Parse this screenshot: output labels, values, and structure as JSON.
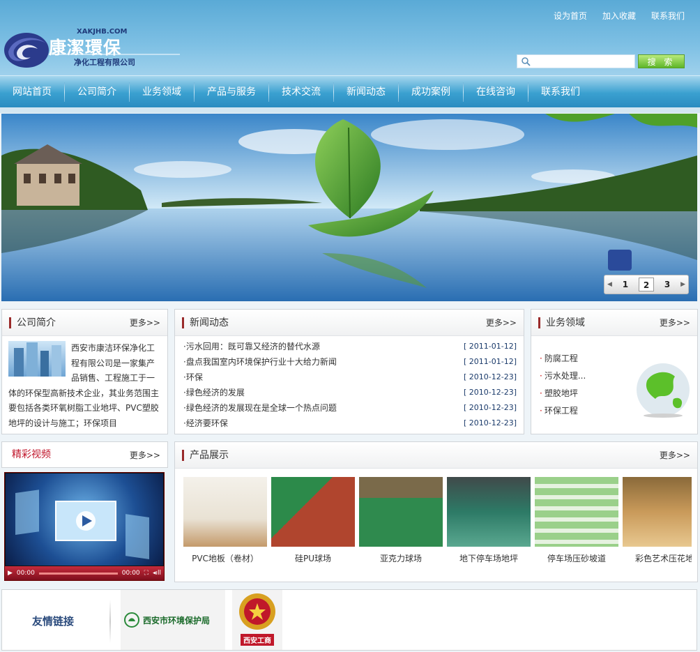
{
  "header": {
    "logo_domain": "XAKJHB.COM",
    "logo_name": "康潔環保",
    "logo_sub": "净化工程有限公司",
    "top_links": [
      "设为首页",
      "加入收藏",
      "联系我们"
    ],
    "search_placeholder": "",
    "search_button": "搜 索"
  },
  "nav": [
    "网站首页",
    "公司简介",
    "业务领域",
    "产品与服务",
    "技术交流",
    "新闻动态",
    "成功案例",
    "在线咨询",
    "联系我们"
  ],
  "banner": {
    "pages": [
      "1",
      "2",
      "3"
    ],
    "active_page": "2"
  },
  "about": {
    "title": "公司简介",
    "more": "更多>>",
    "text": "西安市康洁环保净化工程有限公司是一家集产品销售、工程施工于一体的环保型高新技术企业，其业务范围主要包括各类环氧树脂工业地坪、PVC塑胶地坪的设计与施工；环保项目"
  },
  "news": {
    "title": "新闻动态",
    "more": "更多>>",
    "items": [
      {
        "title": "·污水回用：既可靠又经济的替代水源",
        "date": "[ 2011-01-12]"
      },
      {
        "title": "·盘点我国室内环境保护行业十大给力新闻",
        "date": "[ 2011-01-12]"
      },
      {
        "title": "·环保",
        "date": "[ 2010-12-23]"
      },
      {
        "title": "·绿色经济的发展",
        "date": "[ 2010-12-23]"
      },
      {
        "title": "·绿色经济的发展现在是全球一个热点问题",
        "date": "[ 2010-12-23]"
      },
      {
        "title": "·经济要环保",
        "date": "[ 2010-12-23]"
      }
    ]
  },
  "biz": {
    "title": "业务领域",
    "more": "更多>>",
    "items": [
      "防腐工程",
      "污水处理...",
      "塑胶地坪",
      "环保工程"
    ]
  },
  "video": {
    "title": "精彩视频",
    "more": "更多>>",
    "time_current": "00:00",
    "time_total": "00:00"
  },
  "products": {
    "title": "产品展示",
    "more": "更多>>",
    "items": [
      {
        "name": "PVC地板（卷材）",
        "color": "#e9e2d4"
      },
      {
        "name": "硅PU球场",
        "color": "#b0452e"
      },
      {
        "name": "亚克力球场",
        "color": "#2f8a4e"
      },
      {
        "name": "地下停车场地坪",
        "color": "#2d7a66"
      },
      {
        "name": "停车场压砂坡道",
        "color": "#6fb56c"
      },
      {
        "name": "彩色艺术压花地",
        "color": "#c99a5a"
      }
    ]
  },
  "links": {
    "label": "友情链接",
    "items": [
      "西安市环境保护局",
      "西安工商"
    ]
  }
}
